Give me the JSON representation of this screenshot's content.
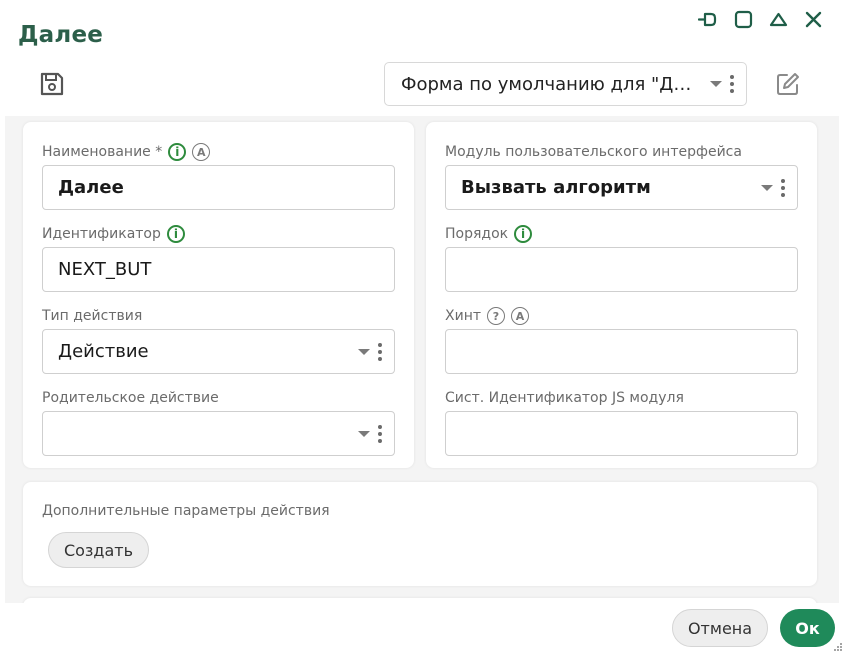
{
  "window": {
    "title": "Далее",
    "controls": [
      "pin-icon",
      "maximize-icon",
      "collapse-icon",
      "close-icon"
    ]
  },
  "toolbar": {
    "save_icon": "save-icon",
    "form_select_value": "Форма по умолчанию для \"Действие\"",
    "edit_icon": "edit-icon"
  },
  "left": {
    "name_label": "Наименование *",
    "name_value": "Далее",
    "id_label": "Идентификатор",
    "id_value": "NEXT_BUT",
    "type_label": "Тип действия",
    "type_value": "Действие",
    "parent_label": "Родительское действие",
    "parent_value": ""
  },
  "right": {
    "module_label": "Модуль пользовательского интерфейса",
    "module_value": "Вызвать алгоритм",
    "order_label": "Порядок",
    "order_value": "",
    "hint_label": "Хинт",
    "hint_value": "",
    "js_label": "Сист. Идентификатор JS модуля",
    "js_value": ""
  },
  "extra": {
    "label": "Дополнительные параметры действия",
    "create_label": "Создать"
  },
  "footer": {
    "cancel_label": "Отмена",
    "ok_label": "Ок"
  },
  "colors": {
    "title": "#2c5f4a",
    "accent": "#1f8a5a",
    "info": "#2e8b3d"
  }
}
